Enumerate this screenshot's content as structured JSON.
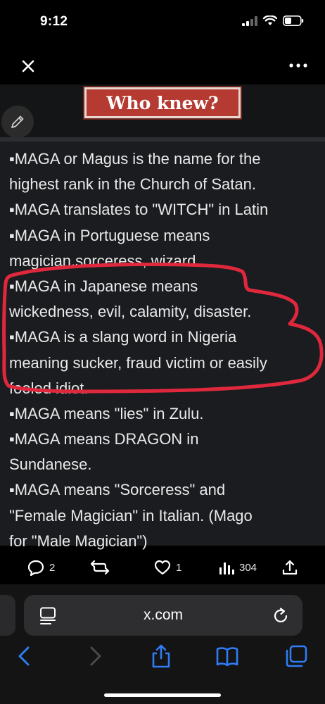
{
  "status_bar": {
    "time": "9:12"
  },
  "post": {
    "title": "Who knew?",
    "lines": [
      "▪MAGA or Magus is the name for the",
      "highest rank in the Church of Satan.",
      "▪MAGA translates to \"WITCH\" in Latin",
      "▪MAGA in Portuguese means",
      "magician,sorceress, wizard.",
      "▪MAGA in Japanese means",
      "wickedness, evil, calamity, disaster.",
      "▪MAGA is a slang word in Nigeria",
      "meaning sucker, fraud victim or easily",
      "fooled idiot.",
      "▪MAGA means \"lies\" in Zulu.",
      "▪MAGA means DRAGON in",
      "Sundanese.",
      "▪MAGA means \"Sorceress\" and",
      "\"Female Magician\" in Italian. (Mago",
      "for \"Male Magician\")"
    ]
  },
  "actions": {
    "replies": "2",
    "likes": "1",
    "views": "304"
  },
  "browser": {
    "url": "x.com"
  },
  "colors": {
    "title_bg": "#b53a32",
    "highlight": "#e0283d",
    "accent": "#2f7cf6"
  }
}
